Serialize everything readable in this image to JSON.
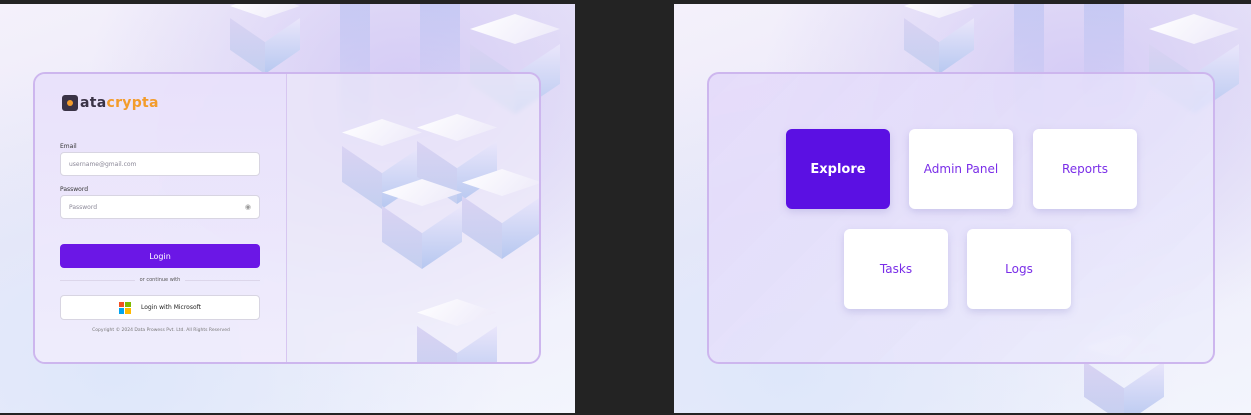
{
  "login_screen": {
    "logo": {
      "mark_letter": "D",
      "text_part1": "ata",
      "text_part2": "crypta",
      "brand_dark": "#3a3346",
      "brand_orange": "#f39c2b"
    },
    "email": {
      "label": "Email",
      "placeholder": "username@gmail.com"
    },
    "password": {
      "label": "Password",
      "placeholder": "Password",
      "icon": "eye-off-icon"
    },
    "login_button": "Login",
    "divider_text": "or continue with",
    "microsoft_button": {
      "label": "Login with Microsoft",
      "icon": "microsoft-icon"
    },
    "copyright": "Copyright © 2024 Data Prowess Pvt. Ltd. All Rights Reserved",
    "accent_color": "#6b17e6"
  },
  "menu_screen": {
    "tiles": [
      "Explore",
      "Admin Panel",
      "Reports",
      "Tasks",
      "Logs"
    ],
    "selected": "Explore",
    "accent_color": "#5b10e3"
  }
}
